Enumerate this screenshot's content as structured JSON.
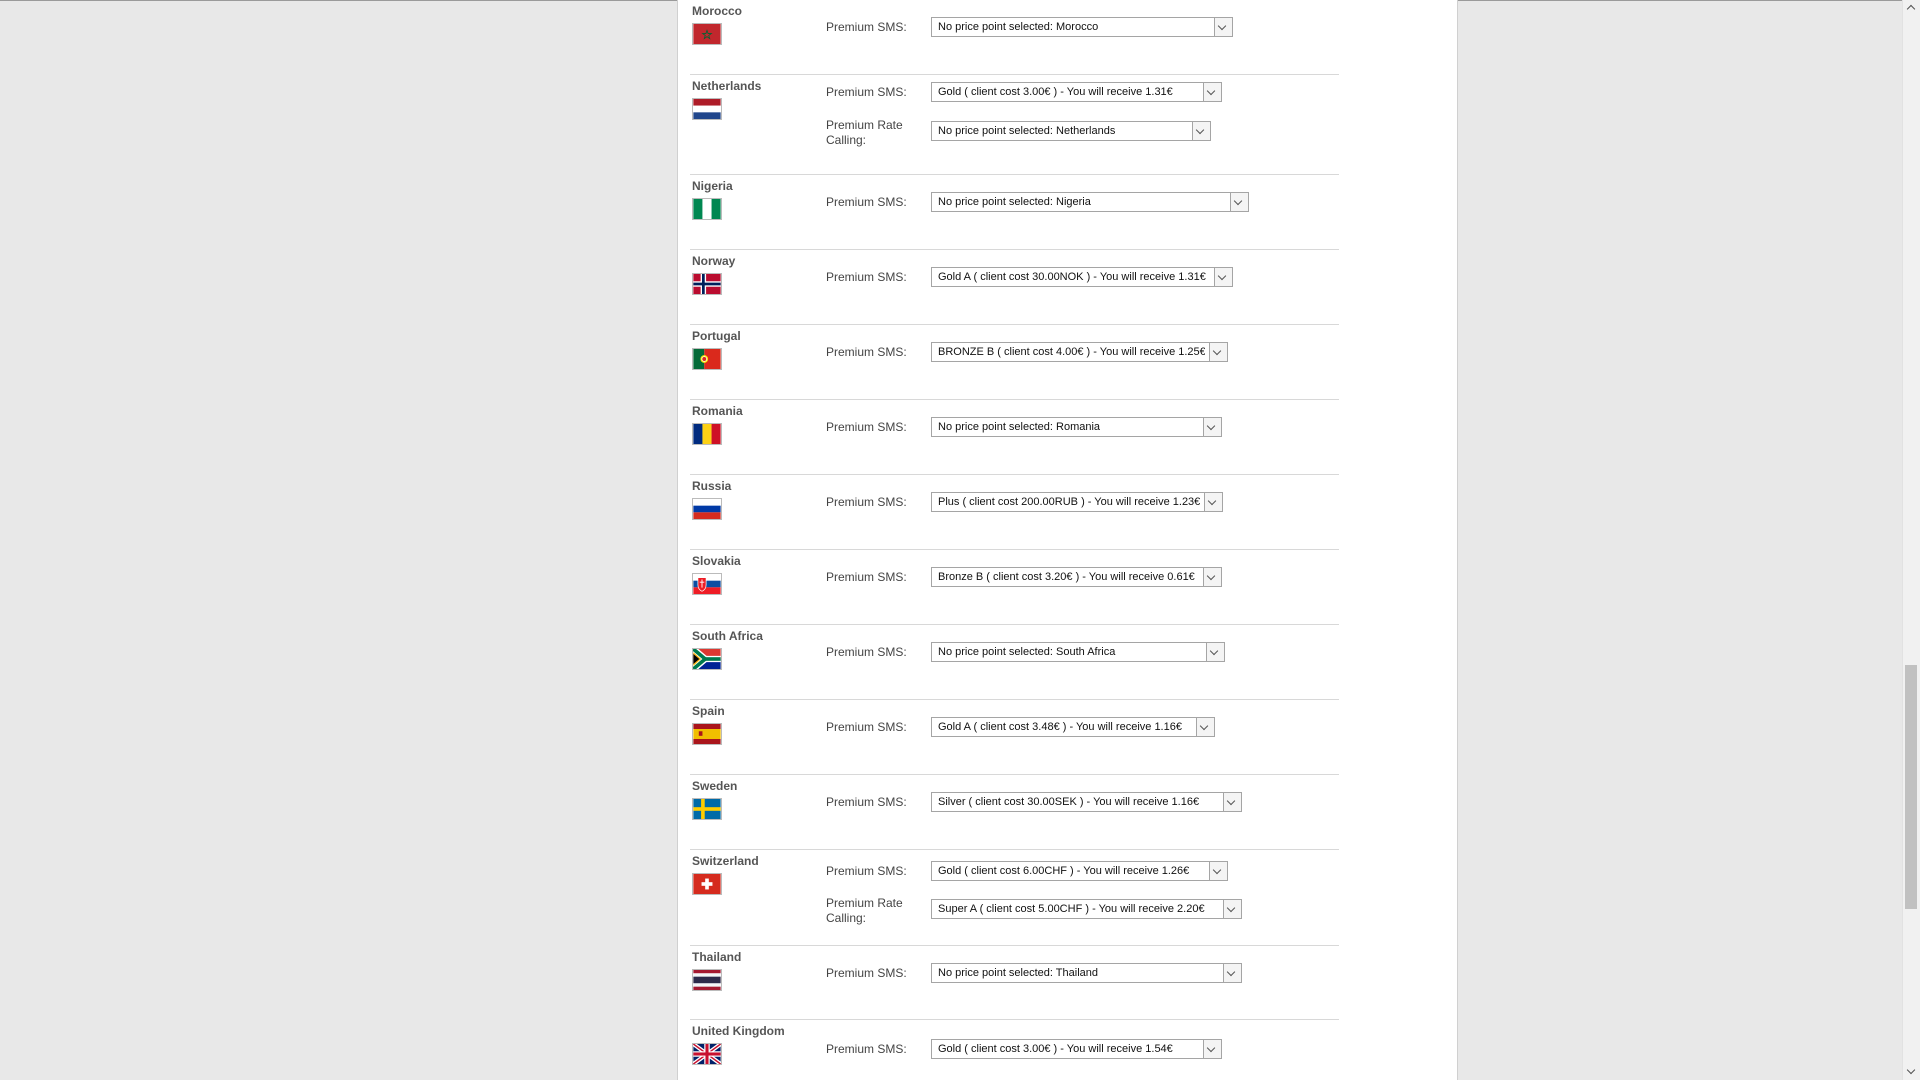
{
  "countries": [
    {
      "key": "morocco",
      "name": "Morocco",
      "flag": "morocco-flag",
      "fields": [
        {
          "label": "Premium SMS:",
          "value": "No price point selected: Morocco"
        }
      ]
    },
    {
      "key": "netherlands",
      "name": "Netherlands",
      "flag": "netherlands-flag",
      "fields": [
        {
          "label": "Premium SMS:",
          "value": "Gold ( client cost 3.00€ ) - You will receive 1.31€"
        },
        {
          "label": "Premium Rate Calling:",
          "value": "No price point selected: Netherlands"
        }
      ]
    },
    {
      "key": "nigeria",
      "name": "Nigeria",
      "flag": "nigeria-flag",
      "fields": [
        {
          "label": "Premium SMS:",
          "value": "No price point selected: Nigeria"
        }
      ]
    },
    {
      "key": "norway",
      "name": "Norway",
      "flag": "norway-flag",
      "fields": [
        {
          "label": "Premium SMS:",
          "value": "Gold A ( client cost 30.00NOK ) - You will receive 1.31€"
        }
      ]
    },
    {
      "key": "portugal",
      "name": "Portugal",
      "flag": "portugal-flag",
      "fields": [
        {
          "label": "Premium SMS:",
          "value": "BRONZE B ( client cost 4.00€ ) - You will receive 1.25€"
        }
      ]
    },
    {
      "key": "romania",
      "name": "Romania",
      "flag": "romania-flag",
      "fields": [
        {
          "label": "Premium SMS:",
          "value": "No price point selected: Romania"
        }
      ]
    },
    {
      "key": "russia",
      "name": "Russia",
      "flag": "russia-flag",
      "fields": [
        {
          "label": "Premium SMS:",
          "value": "Plus ( client cost 200.00RUB ) - You will receive 1.23€"
        }
      ]
    },
    {
      "key": "slovakia",
      "name": "Slovakia",
      "flag": "slovakia-flag",
      "fields": [
        {
          "label": "Premium SMS:",
          "value": "Bronze B ( client cost 3.20€ ) - You will receive 0.61€"
        }
      ]
    },
    {
      "key": "south-africa",
      "name": "South Africa",
      "flag": "south-africa-flag",
      "fields": [
        {
          "label": "Premium SMS:",
          "value": "No price point selected: South Africa"
        }
      ]
    },
    {
      "key": "spain",
      "name": "Spain",
      "flag": "spain-flag",
      "fields": [
        {
          "label": "Premium SMS:",
          "value": "Gold A ( client cost 3.48€ ) - You will receive 1.16€"
        }
      ]
    },
    {
      "key": "sweden",
      "name": "Sweden",
      "flag": "sweden-flag",
      "fields": [
        {
          "label": "Premium SMS:",
          "value": "Silver ( client cost 30.00SEK ) - You will receive 1.16€"
        }
      ]
    },
    {
      "key": "switzerland",
      "name": "Switzerland",
      "flag": "switzerland-flag",
      "fields": [
        {
          "label": "Premium SMS:",
          "value": "Gold ( client cost 6.00CHF ) - You will receive 1.26€"
        },
        {
          "label": "Premium Rate Calling:",
          "value": "Super A ( client cost 5.00CHF ) - You will receive 2.20€"
        }
      ]
    },
    {
      "key": "thailand",
      "name": "Thailand",
      "flag": "thailand-flag",
      "fields": [
        {
          "label": "Premium SMS:",
          "value": "No price point selected: Thailand"
        }
      ]
    },
    {
      "key": "united-kingdom",
      "name": "United Kingdom",
      "flag": "united-kingdom-flag",
      "fields": [
        {
          "label": "Premium SMS:",
          "value": "Gold ( client cost 3.00€ ) - You will receive 1.54€"
        }
      ]
    }
  ]
}
